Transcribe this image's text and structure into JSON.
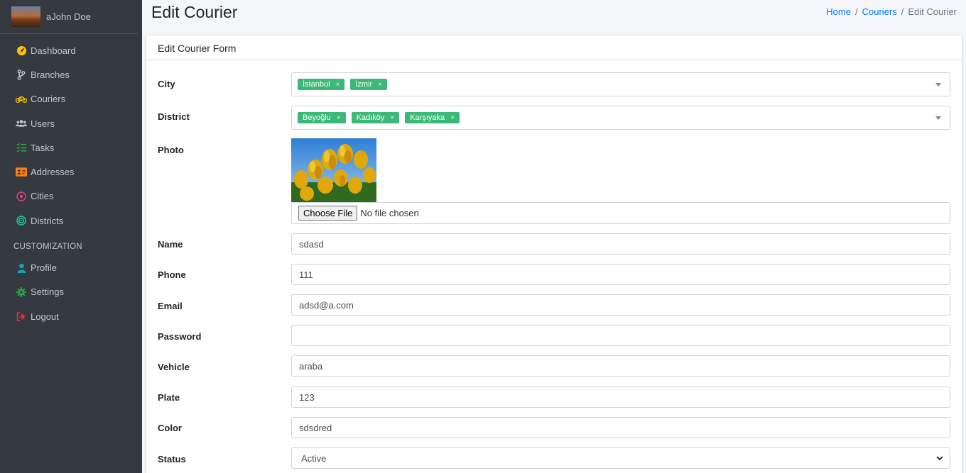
{
  "sidebar": {
    "user_name": "aJohn Doe",
    "items": [
      {
        "label": "Dashboard",
        "icon": "tachometer-icon",
        "color": "#ffc107"
      },
      {
        "label": "Branches",
        "icon": "code-branch-icon",
        "color": "#c2c7d0"
      },
      {
        "label": "Couriers",
        "icon": "bicycle-icon",
        "color": "#ffc107"
      },
      {
        "label": "Users",
        "icon": "users-icon",
        "color": "#c2c7d0"
      },
      {
        "label": "Tasks",
        "icon": "tasks-icon",
        "color": "#28a745"
      },
      {
        "label": "Addresses",
        "icon": "address-card-icon",
        "color": "#fd7e14"
      },
      {
        "label": "Cities",
        "icon": "dot-circle-icon",
        "color": "#e83e8c"
      },
      {
        "label": "Districts",
        "icon": "target-icon",
        "color": "#20c997"
      }
    ],
    "section_header": "CUSTOMIZATION",
    "custom_items": [
      {
        "label": "Profile",
        "icon": "user-icon",
        "color": "#17a2b8"
      },
      {
        "label": "Settings",
        "icon": "cog-icon",
        "color": "#28a745"
      },
      {
        "label": "Logout",
        "icon": "sign-out-icon",
        "color": "#dc3545"
      }
    ]
  },
  "header": {
    "title": "Edit Courier",
    "breadcrumb": [
      "Home",
      "Couriers",
      "Edit Courier"
    ]
  },
  "form": {
    "card_title": "Edit Courier Form",
    "city_label": "City",
    "city_tags": [
      "İstanbul",
      "İzmir"
    ],
    "district_label": "District",
    "district_tags": [
      "Beyoğlu",
      "Kadıköy",
      "Karşıyaka"
    ],
    "photo_label": "Photo",
    "photo_icon": "tulip-photo",
    "file_button": "Choose File",
    "file_status": "No file chosen",
    "name_label": "Name",
    "name_value": "sdasd",
    "phone_label": "Phone",
    "phone_value": "111",
    "email_label": "Email",
    "email_value": "adsd@a.com",
    "password_label": "Password",
    "password_value": "",
    "vehicle_label": "Vehicle",
    "vehicle_value": "araba",
    "plate_label": "Plate",
    "plate_value": "123",
    "color_label": "Color",
    "color_value": "sdsdred",
    "status_label": "Status",
    "status_value": "Active"
  },
  "colors": {
    "sidebar_bg": "#343a40",
    "tag_bg": "#3cb878",
    "link": "#007bff"
  }
}
